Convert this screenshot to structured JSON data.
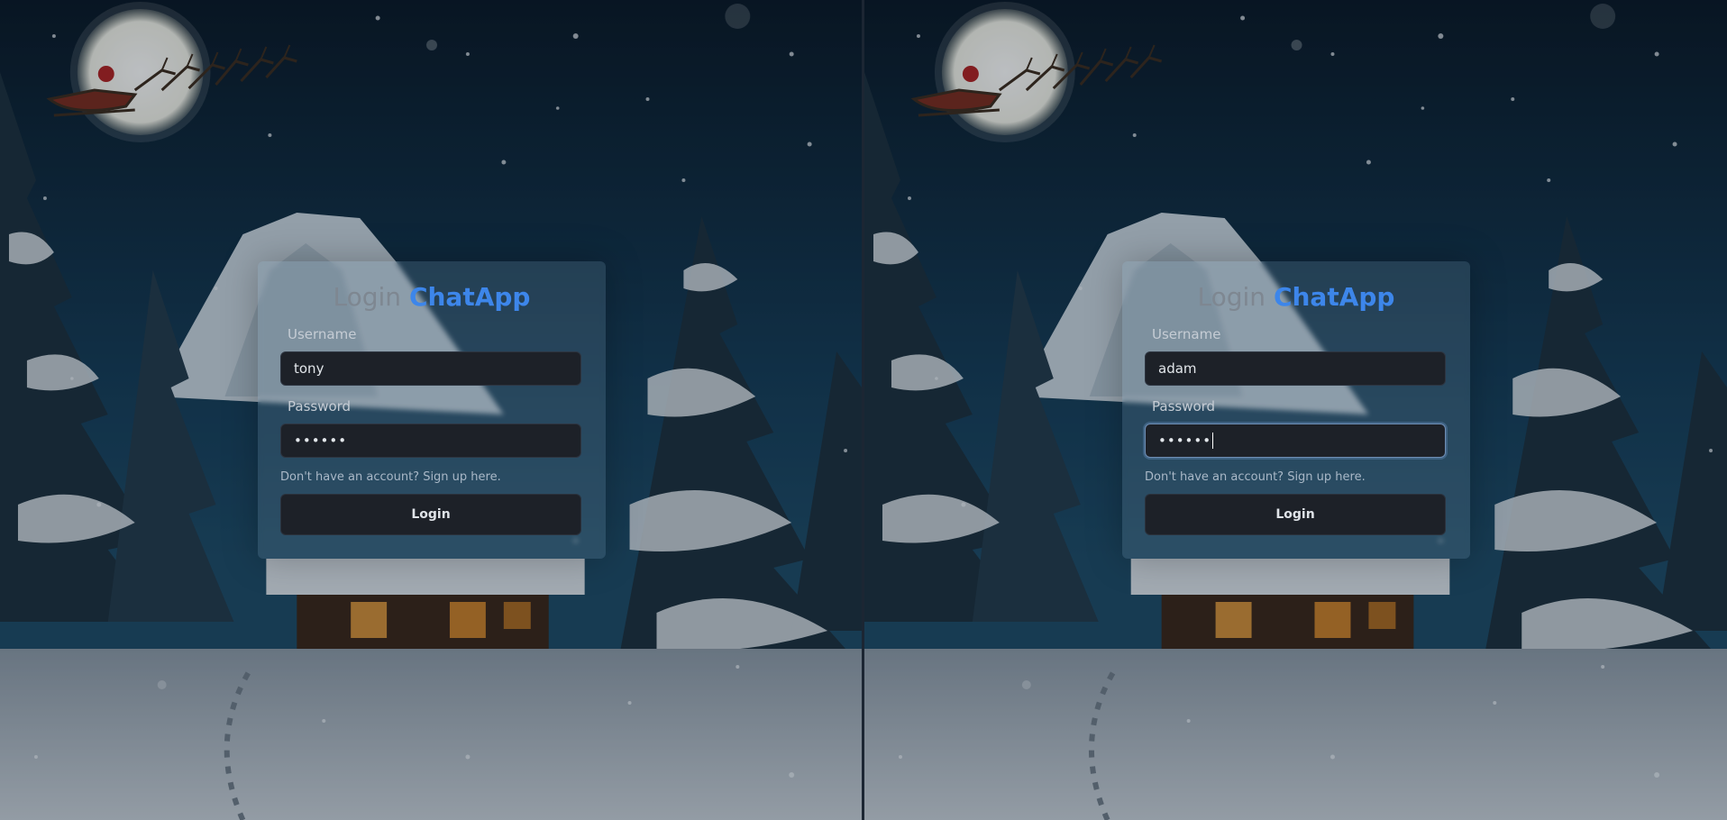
{
  "screens": [
    {
      "title_prefix": "Login",
      "title_app": "ChatApp",
      "username_label": "Username",
      "username_value": "tony",
      "password_label": "Password",
      "password_masked": "••••••",
      "signup_text": "Don't have an account? Sign up here.",
      "login_button": "Login",
      "password_focused": false
    },
    {
      "title_prefix": "Login",
      "title_app": "ChatApp",
      "username_label": "Username",
      "username_value": "adam",
      "password_label": "Password",
      "password_masked": "••••••",
      "signup_text": "Don't have an account? Sign up here.",
      "login_button": "Login",
      "password_focused": true
    }
  ],
  "colors": {
    "accent": "#3d86ea",
    "card": "#1d2128",
    "sky_top": "#0b1a2c",
    "snow": "#c9d1d9"
  },
  "icons": [
    "moon-icon",
    "santa-sleigh-icon",
    "cabin-icon",
    "pine-tree-icon",
    "snowflake-icon"
  ]
}
